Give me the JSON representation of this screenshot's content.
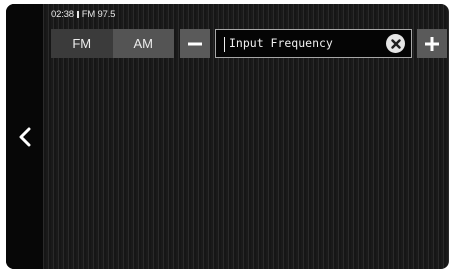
{
  "status_bar": {
    "time": "02:38",
    "station": "FM 97.5"
  },
  "band": {
    "tabs": [
      {
        "label": "FM"
      },
      {
        "label": "AM"
      }
    ]
  },
  "frequency_input": {
    "placeholder": "Input Frequency",
    "value": ""
  },
  "icons": {
    "back": "chevron-left-icon",
    "decrease": "minus-icon",
    "increase": "plus-icon",
    "clear": "clear-circle-icon",
    "status_separator": "separator-icon"
  },
  "colors": {
    "background": "#1c1c1c",
    "button": "#5a5a5a",
    "selected_tab": "#545454",
    "text": "#ececec"
  }
}
